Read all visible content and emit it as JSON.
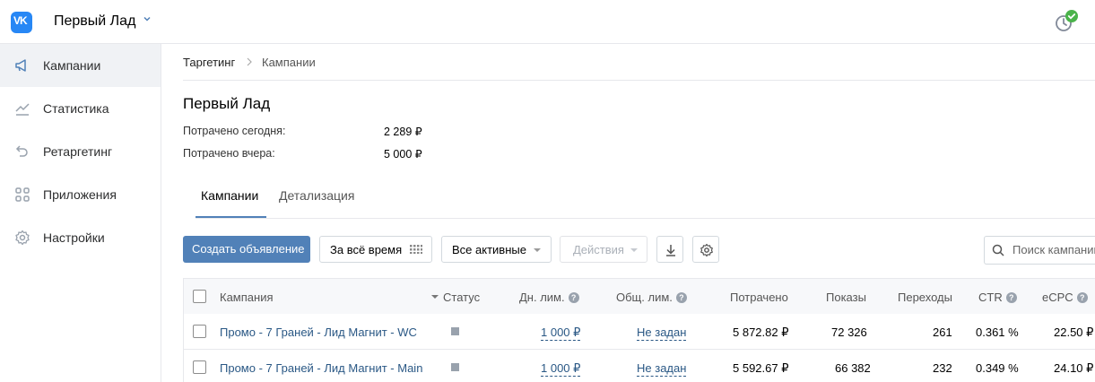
{
  "header": {
    "account_name": "Первый Лад",
    "logo_text": "VK"
  },
  "sidebar": {
    "items": [
      {
        "label": "Кампании",
        "icon": "megaphone-icon",
        "active": true
      },
      {
        "label": "Статистика",
        "icon": "chart-icon",
        "active": false
      },
      {
        "label": "Ретаргетинг",
        "icon": "retarget-icon",
        "active": false
      },
      {
        "label": "Приложения",
        "icon": "apps-icon",
        "active": false
      },
      {
        "label": "Настройки",
        "icon": "gear-icon",
        "active": false
      }
    ]
  },
  "breadcrumb": {
    "items": [
      "Таргетинг",
      "Кампании"
    ]
  },
  "page": {
    "title": "Первый Лад",
    "stats": [
      {
        "label": "Потрачено сегодня:",
        "value": "2 289 ₽"
      },
      {
        "label": "Потрачено вчера:",
        "value": "5 000 ₽"
      }
    ]
  },
  "tabs": [
    {
      "label": "Кампании",
      "active": true
    },
    {
      "label": "Детализация",
      "active": false
    }
  ],
  "toolbar": {
    "create_label": "Создать объявление",
    "period_label": "За всё время",
    "filter_label": "Все активные",
    "actions_label": "Действия",
    "search_placeholder": "Поиск кампании"
  },
  "table": {
    "columns": [
      "Кампания",
      "Статус",
      "Дн. лим.",
      "Общ. лим.",
      "Потрачено",
      "Показы",
      "Переходы",
      "CTR",
      "eCPC"
    ],
    "rows": [
      {
        "name": "Промо - 7 Граней - Лид Магнит - WC",
        "daily_limit": "1 000 ₽",
        "total_limit": "Не задан",
        "spent": "5 872.82 ₽",
        "impressions": "72 326",
        "clicks": "261",
        "ctr": "0.361 %",
        "ecpc": "22.50 ₽"
      },
      {
        "name": "Промо - 7 Граней - Лид Магнит - Main",
        "daily_limit": "1 000 ₽",
        "total_limit": "Не задан",
        "spent": "5 592.67 ₽",
        "impressions": "66 382",
        "clicks": "232",
        "ctr": "0.349 %",
        "ecpc": "24.10 ₽"
      }
    ]
  },
  "colors": {
    "brand": "#2787f5",
    "accent": "#5181b8",
    "link": "#2a5885",
    "status_ok": "#4bb34b"
  }
}
